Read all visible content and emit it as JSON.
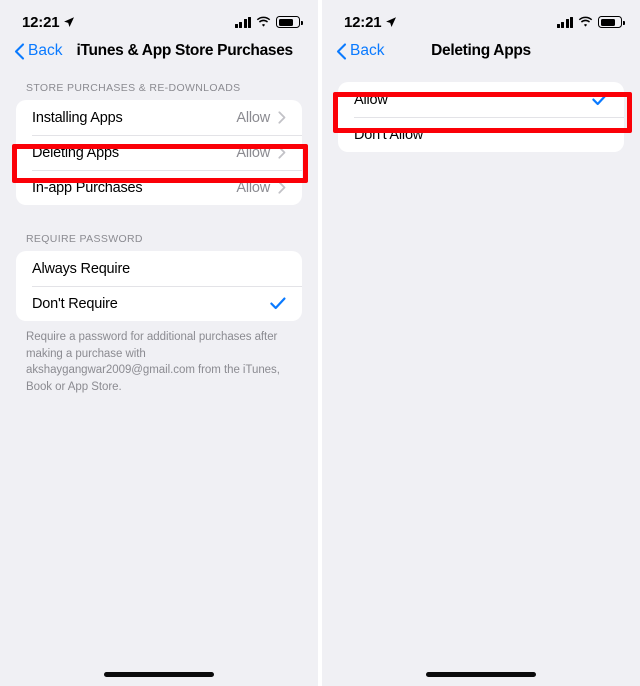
{
  "status_bar": {
    "time": "12:21",
    "location_icon": "location-arrow-icon",
    "signal_icon": "cellular-signal-icon",
    "wifi_icon": "wifi-icon",
    "battery_icon": "battery-icon"
  },
  "colors": {
    "accent_blue": "#0a7aff",
    "highlight_red": "#fb0007",
    "background": "#f0f0f4",
    "card": "#ffffff",
    "secondary_text": "#8b8b91"
  },
  "left_screen": {
    "back_label": "Back",
    "title": "iTunes & App Store Purchases",
    "sections": [
      {
        "header": "STORE PURCHASES & RE-DOWNLOADS",
        "rows": [
          {
            "label": "Installing Apps",
            "value": "Allow",
            "accessory": "chevron-right-icon",
            "highlighted": false
          },
          {
            "label": "Deleting Apps",
            "value": "Allow",
            "accessory": "chevron-right-icon",
            "highlighted": true
          },
          {
            "label": "In-app Purchases",
            "value": "Allow",
            "accessory": "chevron-right-icon",
            "highlighted": false
          }
        ]
      },
      {
        "header": "REQUIRE PASSWORD",
        "rows": [
          {
            "label": "Always Require",
            "value": "",
            "accessory": "none",
            "highlighted": false
          },
          {
            "label": "Don't Require",
            "value": "",
            "accessory": "checkmark-icon",
            "highlighted": false
          }
        ],
        "footer": "Require a password for additional purchases after making a purchase with akshaygangwar2009@gmail.com from the iTunes, Book or App Store."
      }
    ]
  },
  "right_screen": {
    "back_label": "Back",
    "title": "Deleting Apps",
    "sections": [
      {
        "header": "",
        "rows": [
          {
            "label": "Allow",
            "value": "",
            "accessory": "checkmark-icon",
            "highlighted": true
          },
          {
            "label": "Don't Allow",
            "value": "",
            "accessory": "none",
            "highlighted": false
          }
        ]
      }
    ]
  }
}
